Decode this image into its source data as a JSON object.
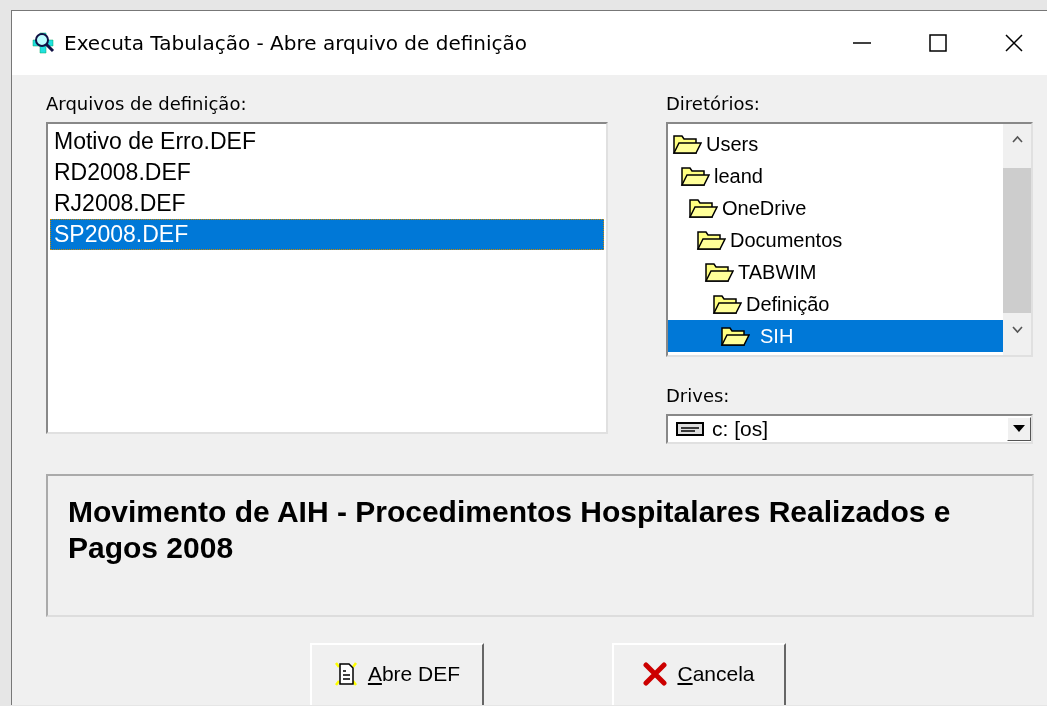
{
  "window": {
    "title": "Executa Tabulação - Abre arquivo de definição"
  },
  "files": {
    "label": "Arquivos de definição:",
    "items": [
      {
        "name": "Motivo de Erro.DEF",
        "selected": false
      },
      {
        "name": "RD2008.DEF",
        "selected": false
      },
      {
        "name": "RJ2008.DEF",
        "selected": false
      },
      {
        "name": "SP2008.DEF",
        "selected": true
      }
    ]
  },
  "directories": {
    "label": "Diretórios:",
    "tree": [
      {
        "name": "Users",
        "selected": false,
        "children": [
          {
            "name": "leand",
            "selected": false,
            "children": [
              {
                "name": "OneDrive",
                "selected": false,
                "children": [
                  {
                    "name": "Documentos",
                    "selected": false,
                    "children": [
                      {
                        "name": "TABWIM",
                        "selected": false,
                        "children": [
                          {
                            "name": "Definição",
                            "selected": false,
                            "children": [
                              {
                                "name": "SIH",
                                "selected": true
                              }
                            ]
                          }
                        ]
                      }
                    ]
                  }
                ]
              }
            ]
          }
        ]
      }
    ]
  },
  "drives": {
    "label": "Drives:",
    "value": "c: [os]"
  },
  "description": " Movimento de AIH - Procedimentos Hospitalares Realizados e Pagos 2008",
  "buttons": [
    {
      "kind": "open",
      "label": "Abre DEF"
    },
    {
      "kind": "cancel",
      "label": "Cancela"
    }
  ]
}
